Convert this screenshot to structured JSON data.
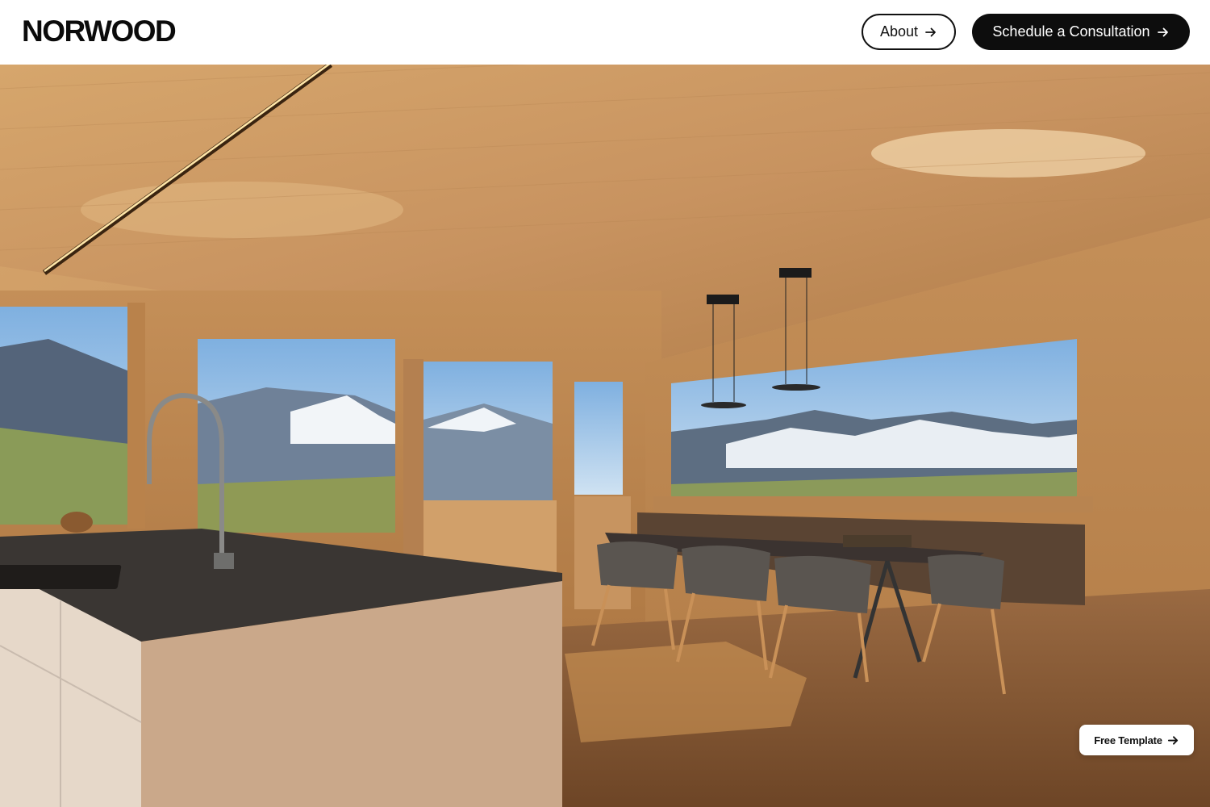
{
  "brand": {
    "logo_text": "NORWOOD"
  },
  "nav": {
    "about_label": "About",
    "consult_label": "Schedule a Consultation"
  },
  "badge": {
    "label": "Free Template"
  },
  "icons": {
    "arrow": "arrow-right-icon"
  },
  "colors": {
    "primary": "#0d0d0d",
    "background": "#ffffff",
    "wood": "#c89460"
  }
}
